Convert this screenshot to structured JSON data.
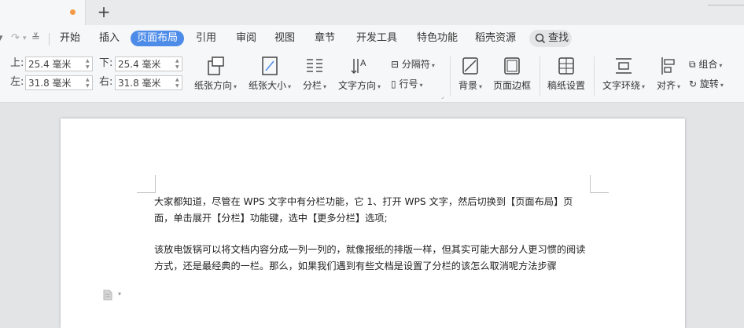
{
  "tabbar": {
    "new_tab": "+"
  },
  "quick_access": {
    "undo": "↶",
    "undo_caret": "▾",
    "redo": "↷",
    "customize": "≚"
  },
  "menu": {
    "items": [
      "开始",
      "插入",
      "页面布局",
      "引用",
      "审阅",
      "视图",
      "章节",
      "开发工具",
      "特色功能",
      "稻壳资源"
    ],
    "active": "页面布局",
    "search_label": "查找"
  },
  "ribbon": {
    "margins": {
      "top_label": "上:",
      "top_value": "25.4 毫米",
      "bottom_label": "下:",
      "bottom_value": "25.4 毫米",
      "left_label": "左:",
      "left_value": "31.8 毫米",
      "right_label": "右:",
      "right_value": "31.8 毫米"
    },
    "orientation": "纸张方向",
    "paper_size": "纸张大小",
    "columns": "分栏",
    "text_direction": "文字方向",
    "separator": "分隔符",
    "line_number": "行号",
    "background": "背景",
    "page_border": "页面边框",
    "manuscript": "稿纸设置",
    "text_wrap": "文字环绕",
    "align": "对齐",
    "group": "组合",
    "rotate": "旋转"
  },
  "document": {
    "paragraph1": "大家都知道，尽管在 WPS 文字中有分栏功能，它 1、打开 WPS 文字，然后切换到【页面布局】页面，单击展开【分栏】功能键，选中【更多分栏】选项;",
    "paragraph2": "该放电饭锅可以将文档内容分成一列一列的，就像报纸的排版一样，但其实可能大部分人更习惯的阅读方式，还是最经典的一栏。那么，如果我们遇到有些文档是设置了分栏的该怎么取消呢方法步骤"
  },
  "colors": {
    "accent": "#4d8be8",
    "tab_dot": "#f29a45",
    "page": "#ffffff",
    "canvas": "#e3e4e6"
  }
}
